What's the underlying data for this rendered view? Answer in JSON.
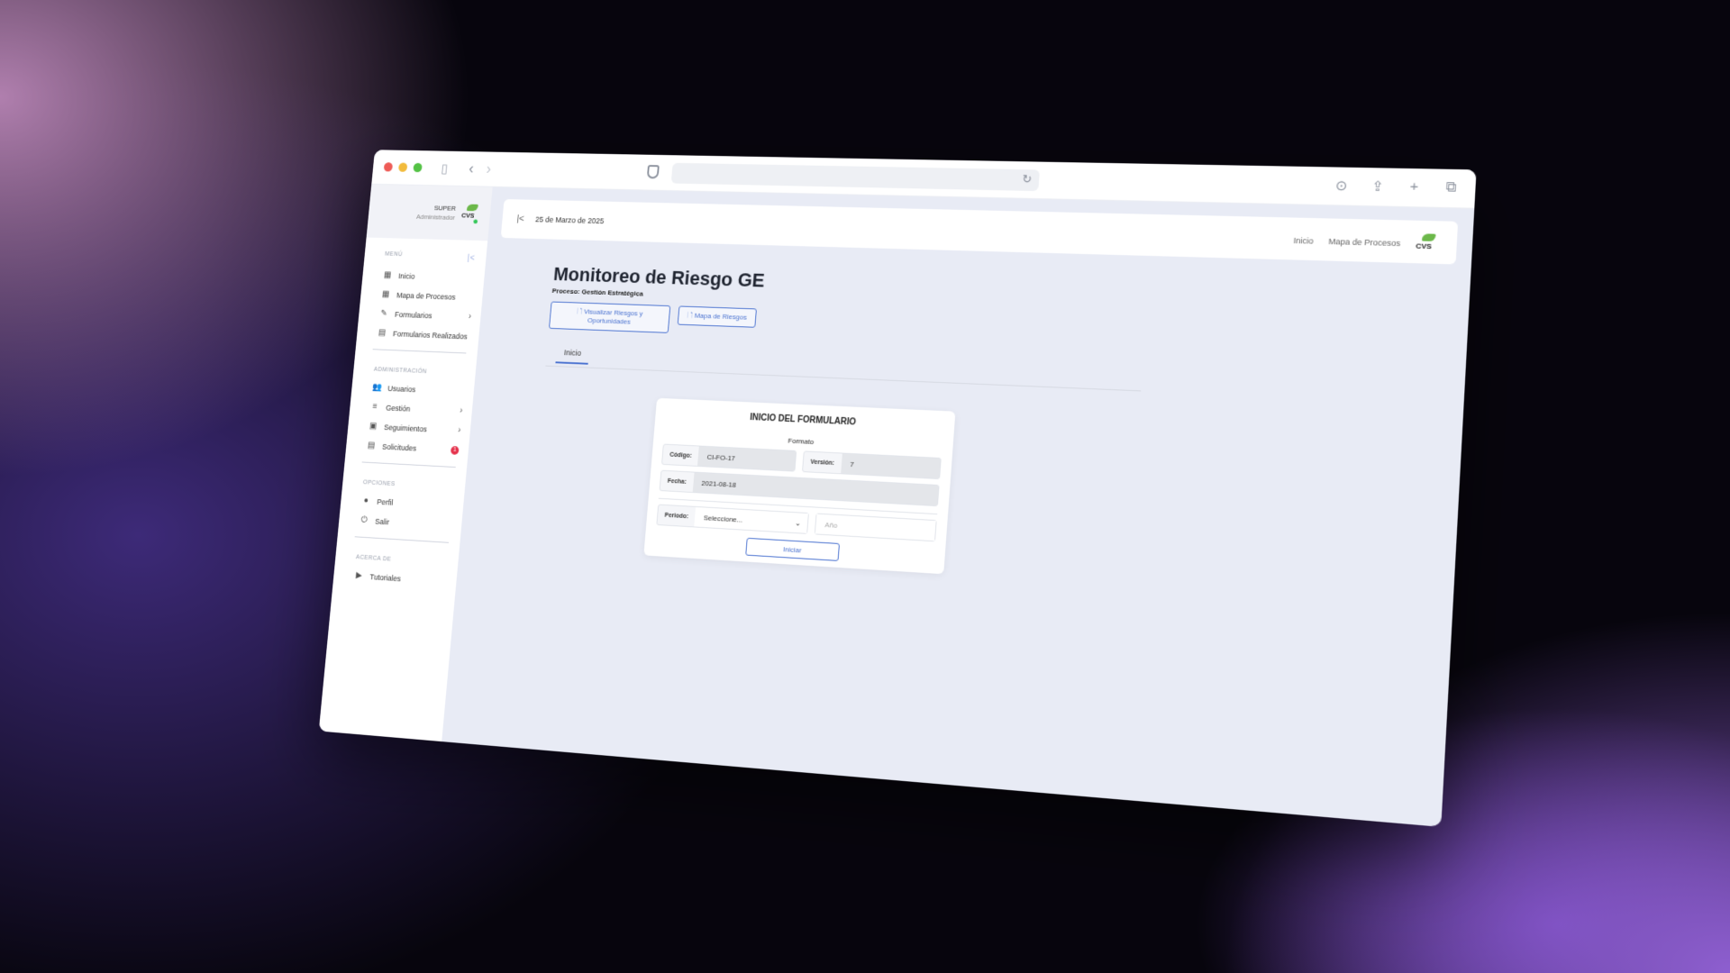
{
  "browser": {
    "address": ""
  },
  "sidebar": {
    "user": {
      "name": "SUPER",
      "role": "Administrador",
      "logo_text": "CVS"
    },
    "sections": {
      "menu": "MENÚ",
      "admin": "ADMINISTRACIÓN",
      "options": "OPCIONES",
      "about": "ACERCA DE"
    },
    "menu_items": [
      "Inicio",
      "Mapa de Procesos",
      "Formularios",
      "Formularios Realizados"
    ],
    "admin_items": [
      "Usuarios",
      "Gestión",
      "Seguimientos",
      "Solicitudes"
    ],
    "option_items": [
      "Perfil",
      "Salir"
    ],
    "about_items": [
      "Tutoriales"
    ],
    "solicitudes_badge": "1"
  },
  "topbar": {
    "date": "25 de Marzo de 2025",
    "links": [
      "Inicio",
      "Mapa de Procesos"
    ],
    "logo_text": "CVS"
  },
  "page": {
    "title": "Monitoreo de Riesgo GE",
    "subtitle": "Proceso: Gestión Estratégica",
    "btn_risks": "Visualizar Riesgos y Oportunidades",
    "btn_map": "Mapa de Riesgos",
    "tab": "Inicio"
  },
  "form": {
    "title": "INICIO DEL FORMULARIO",
    "subtitle": "Formato",
    "codigo_label": "Código:",
    "codigo_value": "CI-FO-17",
    "version_label": "Versión:",
    "version_value": "7",
    "fecha_label": "Fecha:",
    "fecha_value": "2021-08-18",
    "periodo_label": "Periodo:",
    "periodo_value": "Seleccione...",
    "anio_placeholder": "Año",
    "start_button": "Iniciar"
  },
  "colors": {
    "accent": "#4a72d0",
    "badge": "#e5314b",
    "logo_green": "#6cb84a"
  }
}
